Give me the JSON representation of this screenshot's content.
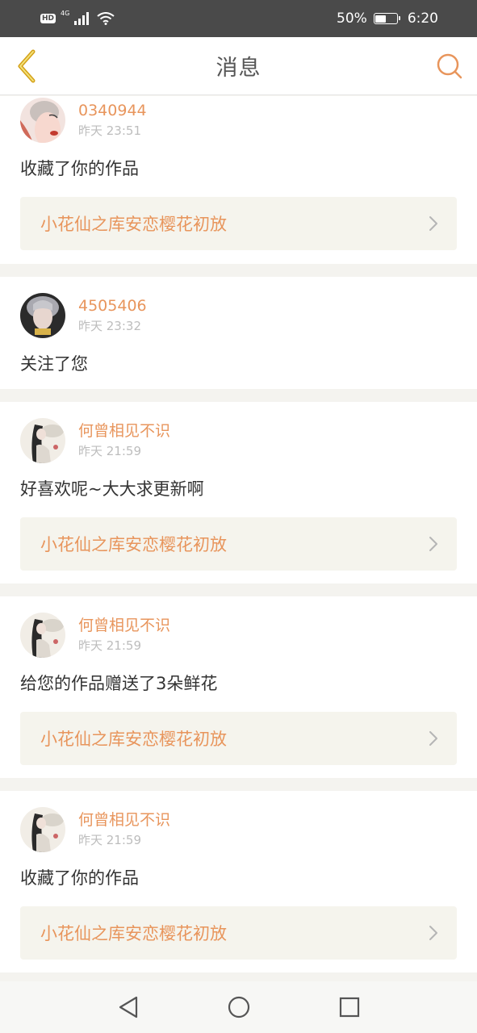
{
  "status_bar": {
    "hd": "HD",
    "network": "4G",
    "battery_percent_text": "50%",
    "battery_level": 0.5,
    "time": "6:20"
  },
  "header": {
    "title": "消息",
    "back_icon": "chevron-left-icon",
    "search_icon": "search-icon",
    "back_color": "#d4a017",
    "search_color": "#e8955c"
  },
  "colors": {
    "accent": "#e8955c",
    "timestamp": "#bdbdbd",
    "text": "#333333",
    "link_bg": "#f5f4ed"
  },
  "messages": [
    {
      "username": "0340944",
      "time": "昨天 23:51",
      "action": "收藏了你的作品",
      "work": "小花仙之库安恋樱花初放"
    },
    {
      "username": "4505406",
      "time": "昨天 23:32",
      "action": "关注了您"
    },
    {
      "username": "何曾相见不识",
      "time": "昨天 21:59",
      "action": "好喜欢呢~大大求更新啊",
      "work": "小花仙之库安恋樱花初放"
    },
    {
      "username": "何曾相见不识",
      "time": "昨天 21:59",
      "action": "给您的作品赠送了3朵鲜花",
      "work": "小花仙之库安恋樱花初放"
    },
    {
      "username": "何曾相见不识",
      "time": "昨天 21:59",
      "action": "收藏了你的作品",
      "work": "小花仙之库安恋樱花初放"
    }
  ],
  "nav": {
    "back_icon": "triangle-back-icon",
    "home_icon": "circle-home-icon",
    "recents_icon": "square-recents-icon"
  }
}
